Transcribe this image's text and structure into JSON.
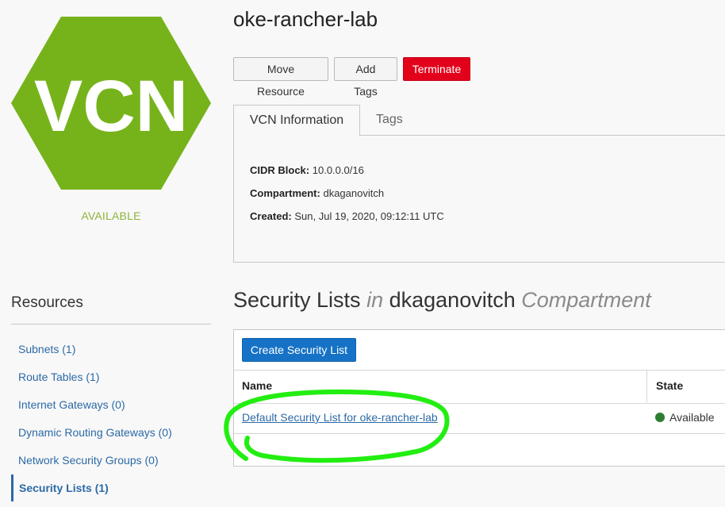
{
  "vcn": {
    "badge_text": "VCN",
    "status": "AVAILABLE",
    "badge_color": "#76b31b"
  },
  "header": {
    "title": "oke-rancher-lab"
  },
  "actions": {
    "move_label": "Move Resource",
    "add_tags_label": "Add Tags",
    "terminate_label": "Terminate"
  },
  "tabs": [
    {
      "label": "VCN Information",
      "active": true
    },
    {
      "label": "Tags",
      "active": false
    }
  ],
  "info": {
    "cidr_label": "CIDR Block:",
    "cidr_value": "10.0.0.0/16",
    "compartment_label": "Compartment:",
    "compartment_value": "dkaganovitch",
    "created_label": "Created:",
    "created_value": "Sun, Jul 19, 2020, 09:12:11 UTC"
  },
  "resources": {
    "heading": "Resources",
    "items": [
      {
        "label": "Subnets (1)",
        "active": false
      },
      {
        "label": "Route Tables (1)",
        "active": false
      },
      {
        "label": "Internet Gateways (0)",
        "active": false
      },
      {
        "label": "Dynamic Routing Gateways (0)",
        "active": false
      },
      {
        "label": "Network Security Groups (0)",
        "active": false
      },
      {
        "label": "Security Lists (1)",
        "active": true
      }
    ]
  },
  "security_lists": {
    "heading_main": "Security Lists",
    "heading_in": "in",
    "heading_compartment": "dkaganovitch",
    "heading_suffix": "Compartment",
    "create_label": "Create Security List",
    "columns": [
      "Name",
      "State"
    ],
    "rows": [
      {
        "name": "Default Security List for oke-rancher-lab",
        "state": "Available",
        "state_color": "#2e7d32"
      }
    ]
  },
  "colors": {
    "accent": "#1672c6",
    "danger": "#e3001b",
    "link": "#2b6aa6",
    "highlight": "#22ee11"
  }
}
